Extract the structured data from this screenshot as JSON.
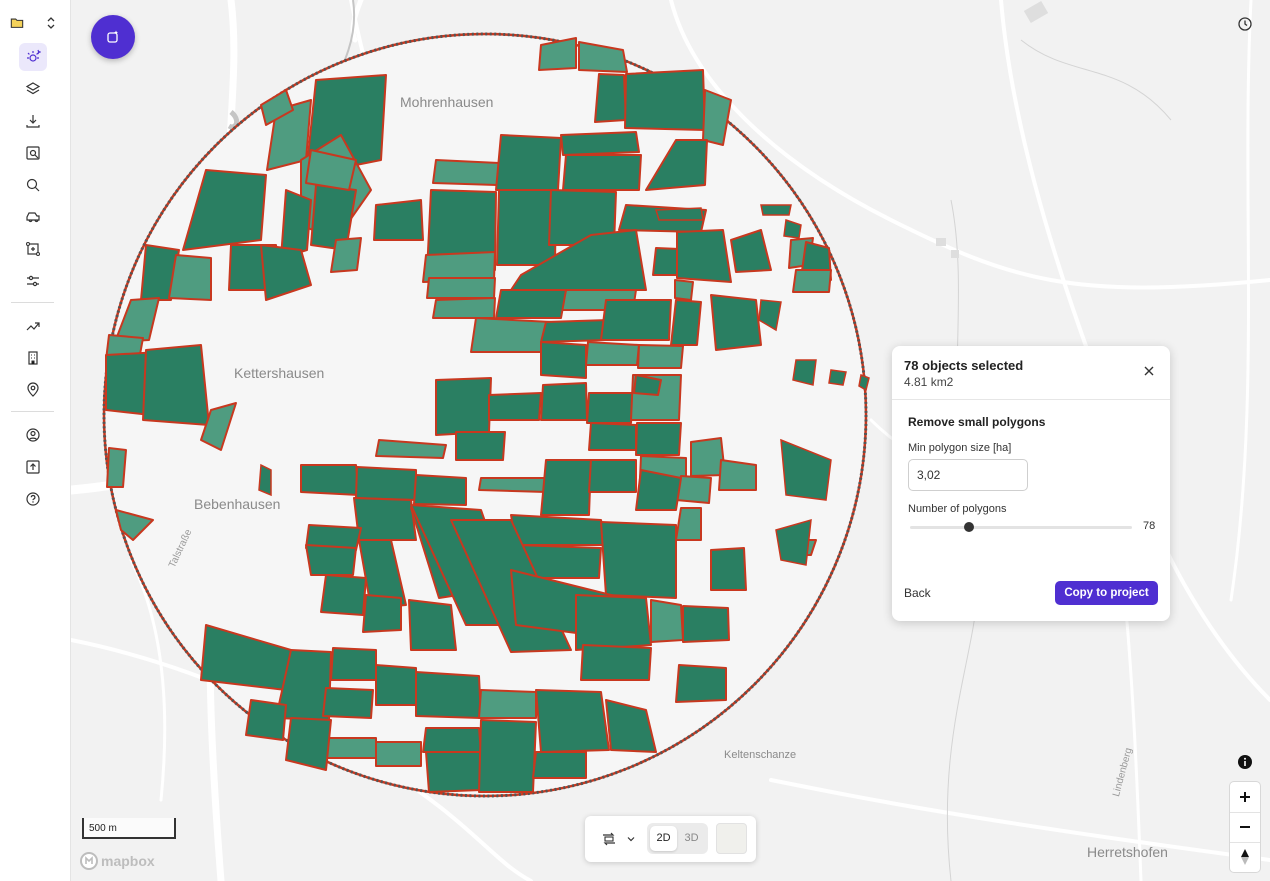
{
  "sidebar": {
    "icons": [
      {
        "name": "folder-icon",
        "active": false
      },
      {
        "name": "chevron-updown-icon",
        "active": false
      },
      {
        "name": "sun-spark-icon",
        "active": true
      },
      {
        "name": "layers-icon",
        "active": false
      },
      {
        "name": "download-icon",
        "active": false
      },
      {
        "name": "search-area-icon",
        "active": false
      },
      {
        "name": "search-icon",
        "active": false
      },
      {
        "name": "vehicle-icon",
        "active": false
      },
      {
        "name": "polygon-icon",
        "active": false
      },
      {
        "name": "sliders-icon",
        "active": false
      },
      {
        "name": "trend-icon",
        "active": false
      },
      {
        "name": "building-icon",
        "active": false
      },
      {
        "name": "location-pin-icon",
        "active": false
      },
      {
        "name": "user-circle-icon",
        "active": false
      },
      {
        "name": "upload-icon",
        "active": false
      },
      {
        "name": "help-icon",
        "active": false
      }
    ]
  },
  "map": {
    "places": {
      "mohrenhausen": "Mohrenhausen",
      "kettershausen": "Kettershausen",
      "bebenhausen": "Bebenhausen",
      "keltenschanze": "Keltenschanze",
      "herretshofen": "Herretshofen",
      "lindenberg": "Lindenberg",
      "talstrasse": "Talstraße"
    },
    "scale_label": "500 m",
    "attribution": "mapbox",
    "colors": {
      "polygon_fill": "#2a7f62",
      "polygon_fill_light": "#4f9c80",
      "polygon_stroke": "#c8381f",
      "circle_stroke": "#555555"
    }
  },
  "panel": {
    "title": "78 objects selected",
    "subtitle": "4.81 km2",
    "section_title": "Remove small polygons",
    "min_size_label": "Min polygon size [ha]",
    "min_size_value": "3,02",
    "slider_label": "Number of polygons",
    "slider_value": "78",
    "back_label": "Back",
    "copy_label": "Copy to project"
  },
  "bottom_bar": {
    "mode_2d": "2D",
    "mode_3d": "3D",
    "active_mode": "2D"
  },
  "accent": "#4f2fd1"
}
